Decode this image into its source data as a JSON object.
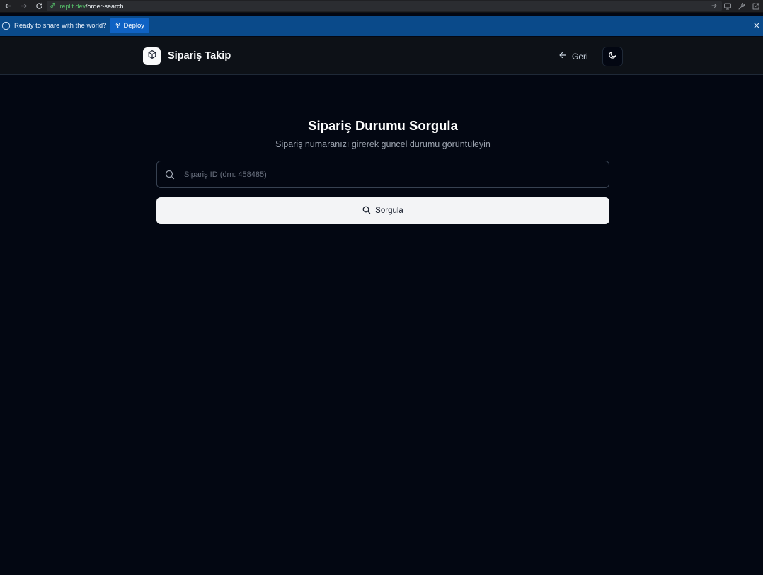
{
  "browser": {
    "url_host": ".replit.dev",
    "url_path": "/order-search"
  },
  "banner": {
    "text": "Ready to share with the world?",
    "deploy_label": "Deploy"
  },
  "header": {
    "app_title": "Sipariş Takip",
    "back_label": "Geri"
  },
  "main": {
    "title": "Sipariş Durumu Sorgula",
    "subtitle": "Sipariş numaranızı girerek güncel durumu görüntüleyin",
    "search": {
      "placeholder": "Sipariş ID (örn: 458485)",
      "value": ""
    },
    "query_label": "Sorgula"
  },
  "colors": {
    "background": "#030712",
    "header_bg": "#0d1117",
    "banner_bg": "#0a4a8a",
    "deploy_bg": "#0f62c4",
    "button_bg": "#f3f4f6",
    "url_host": "#56c16a"
  },
  "icons": {
    "back": "arrow-left-icon",
    "forward": "arrow-right-icon",
    "reload": "reload-icon",
    "info": "info-icon",
    "deploy": "deploy-icon",
    "close": "close-icon",
    "logo": "package-icon",
    "theme": "moon-icon",
    "search": "search-icon"
  }
}
